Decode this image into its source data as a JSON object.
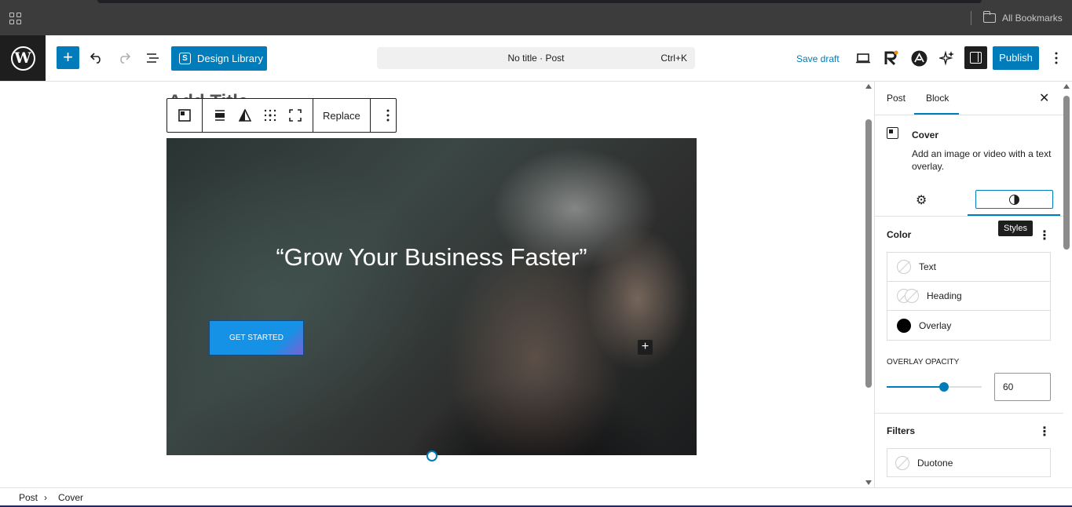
{
  "browser": {
    "bookmarks_label": "All Bookmarks"
  },
  "header": {
    "design_library_label": "Design Library",
    "document_title": "No title · Post",
    "shortcut": "Ctrl+K",
    "save_draft_label": "Save draft",
    "publish_label": "Publish"
  },
  "canvas": {
    "post_title_ghost": "Add Title",
    "toolbar": {
      "replace_label": "Replace"
    },
    "cover": {
      "heading": "“Grow Your Business Faster”",
      "button_label": "GET STARTED"
    }
  },
  "sidebar": {
    "tabs": [
      "Post",
      "Block"
    ],
    "active_tab": "Block",
    "block": {
      "name": "Cover",
      "description": "Add an image or video with a text overlay."
    },
    "styles_tooltip": "Styles",
    "color": {
      "title": "Color",
      "items": [
        {
          "label": "Text"
        },
        {
          "label": "Heading"
        },
        {
          "label": "Overlay",
          "color": "#000000"
        }
      ]
    },
    "overlay_opacity": {
      "label": "Overlay opacity",
      "value": "60",
      "percent": 60
    },
    "filters": {
      "title": "Filters",
      "duotone_label": "Duotone"
    }
  },
  "breadcrumbs": [
    "Post",
    "Cover"
  ],
  "colors": {
    "accent": "#007cba",
    "dark": "#1e1e1e"
  }
}
